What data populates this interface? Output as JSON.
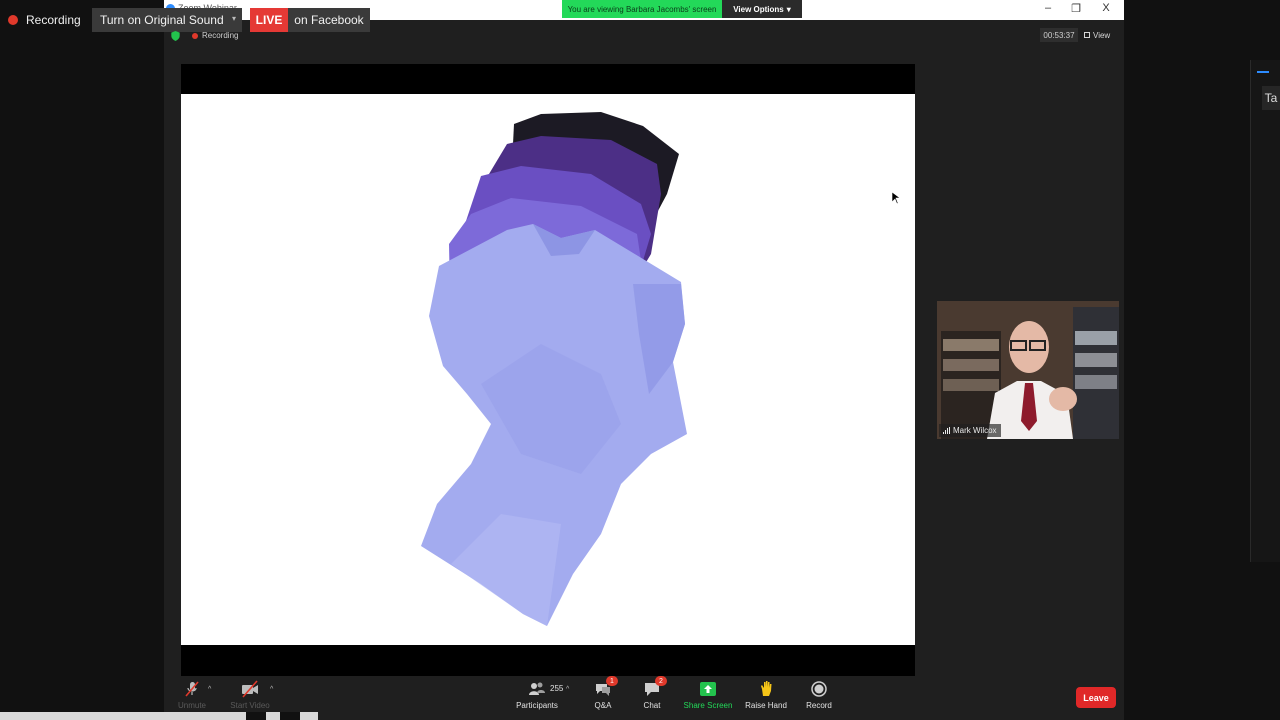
{
  "recording_bar": {
    "recording_label": "Recording",
    "original_sound_label": "Turn on Original Sound",
    "live_label": "LIVE",
    "facebook_label": "on Facebook"
  },
  "window": {
    "app_title": "Zoom Webinar",
    "recording_label": "Recording",
    "viewing_banner": "You are viewing Barbara Jacombs' screen",
    "view_options_label": "View Options",
    "minimize_glyph": "–",
    "restore_glyph": "❐",
    "close_glyph": "X",
    "timer": "00:53:37",
    "view_label": "View"
  },
  "video": {
    "participant_name": "Mark Wilcox"
  },
  "right_panel": {
    "tab_label": "Ta"
  },
  "toolbar": {
    "unmute_label": "Unmute",
    "start_video_label": "Start Video",
    "participants_label": "Participants",
    "participants_count": "255",
    "qa_label": "Q&A",
    "qa_badge": "1",
    "chat_label": "Chat",
    "chat_badge": "2",
    "share_screen_label": "Share Screen",
    "raise_hand_label": "Raise Hand",
    "record_label": "Record",
    "leave_label": "Leave"
  },
  "colors": {
    "live_red": "#e53935",
    "share_green": "#23d959",
    "leave_red": "#e02828",
    "zoom_blue": "#2d8cff",
    "shirt_light": "#9fa8ee",
    "shirt_mid": "#7b6bd6",
    "shirt_dark": "#4c2f86",
    "shirt_black": "#1c1a24"
  }
}
